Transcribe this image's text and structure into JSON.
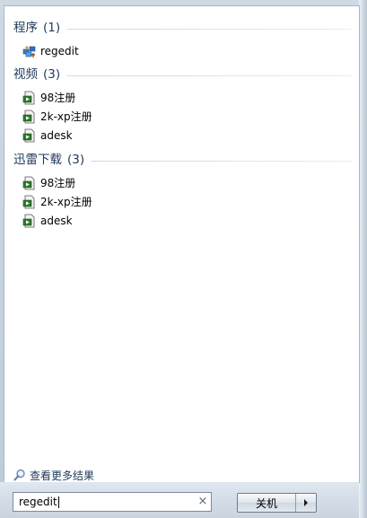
{
  "groups": [
    {
      "title": "程序",
      "count": "(1)",
      "items": [
        {
          "label": "regedit",
          "icon": "regedit-icon"
        }
      ]
    },
    {
      "title": "视频",
      "count": "(3)",
      "items": [
        {
          "label": "98注册",
          "icon": "video-file-icon"
        },
        {
          "label": "2k-xp注册",
          "icon": "video-file-icon"
        },
        {
          "label": "adesk",
          "icon": "video-file-icon"
        }
      ]
    },
    {
      "title": "迅雷下载",
      "count": "(3)",
      "items": [
        {
          "label": "98注册",
          "icon": "video-file-icon"
        },
        {
          "label": "2k-xp注册",
          "icon": "video-file-icon"
        },
        {
          "label": "adesk",
          "icon": "video-file-icon"
        }
      ]
    }
  ],
  "see_more": "查看更多结果",
  "search": {
    "value": "regedit",
    "clear": "×"
  },
  "shutdown": {
    "label": "关机"
  },
  "colors": {
    "header_text": "#1e395b",
    "panel": "#ffffff",
    "frame": "#c9d4df"
  }
}
